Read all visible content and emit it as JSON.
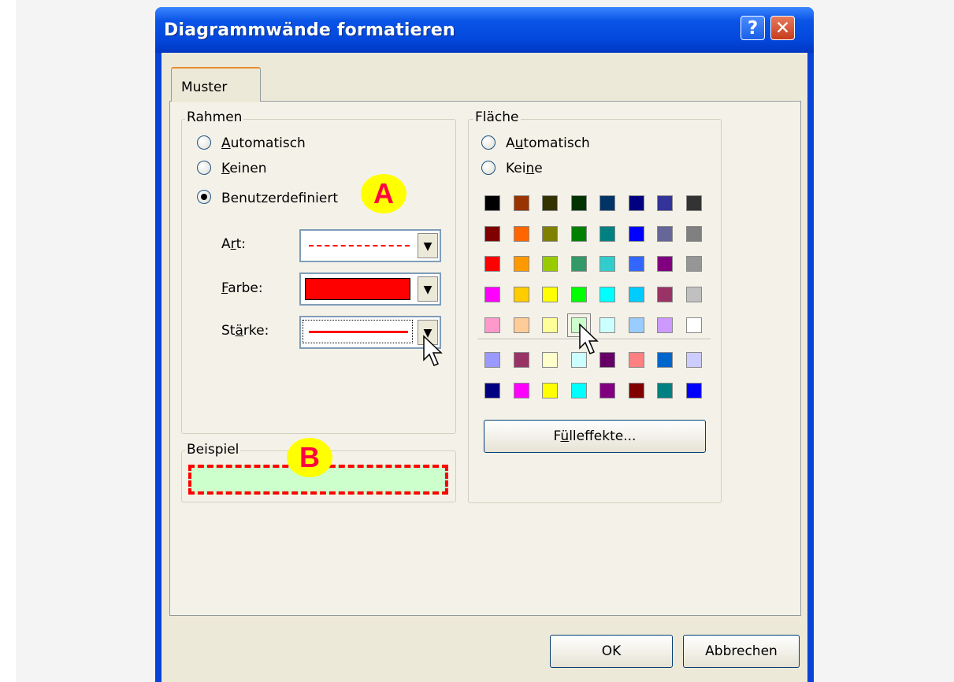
{
  "window": {
    "title": "Diagrammwände formatieren",
    "help_label": "?",
    "close_label": "✕"
  },
  "tabs": [
    {
      "label": "Muster",
      "active": true
    }
  ],
  "rahmen": {
    "label": "Rahmen",
    "options": [
      {
        "label": "Automatisch",
        "checked": false
      },
      {
        "label": "Keinen",
        "checked": false
      },
      {
        "label": "Benutzerdefiniert",
        "checked": true
      }
    ],
    "art_label": "Art:",
    "art_value": "dashed-line-red",
    "farbe_label": "Farbe:",
    "farbe_value": "#ff0000",
    "staerke_label": "Stärke:",
    "staerke_value": "thick-line-red"
  },
  "beispiel": {
    "label": "Beispiel",
    "border_color": "#ff0000",
    "fill_color": "#ccffcc"
  },
  "flaeche": {
    "label": "Fläche",
    "options": [
      {
        "label": "Automatisch",
        "checked": false
      },
      {
        "label": "Keine",
        "checked": false
      }
    ],
    "palette": [
      [
        "#000000",
        "#993300",
        "#333300",
        "#003300",
        "#003366",
        "#000080",
        "#333399",
        "#333333"
      ],
      [
        "#800000",
        "#ff6600",
        "#808000",
        "#008000",
        "#008080",
        "#0000ff",
        "#666699",
        "#808080"
      ],
      [
        "#ff0000",
        "#ff9900",
        "#99cc00",
        "#339966",
        "#33cccc",
        "#3366ff",
        "#800080",
        "#969696"
      ],
      [
        "#ff00ff",
        "#ffcc00",
        "#ffff00",
        "#00ff00",
        "#00ffff",
        "#00ccff",
        "#993366",
        "#c0c0c0"
      ],
      [
        "#ff99cc",
        "#ffcc99",
        "#ffff99",
        "#ccffcc",
        "#ccffff",
        "#99ccff",
        "#cc99ff",
        "#ffffff"
      ]
    ],
    "chart_palette": [
      [
        "#9999ff",
        "#993366",
        "#ffffcc",
        "#ccffff",
        "#660066",
        "#ff8080",
        "#0066cc",
        "#ccccff"
      ],
      [
        "#000080",
        "#ff00ff",
        "#ffff00",
        "#00ffff",
        "#800080",
        "#800000",
        "#008080",
        "#0000ff"
      ]
    ],
    "selected_color": "#ccffcc",
    "fill_effects_label": "Fülleffekte..."
  },
  "buttons": {
    "ok": "OK",
    "cancel": "Abbrechen"
  },
  "annotations": {
    "a": "A",
    "b": "B"
  },
  "icons": {
    "help": "help-icon",
    "close": "close-icon",
    "cursor": "mouse-pointer-icon",
    "dropdown": "chevron-down-icon"
  }
}
